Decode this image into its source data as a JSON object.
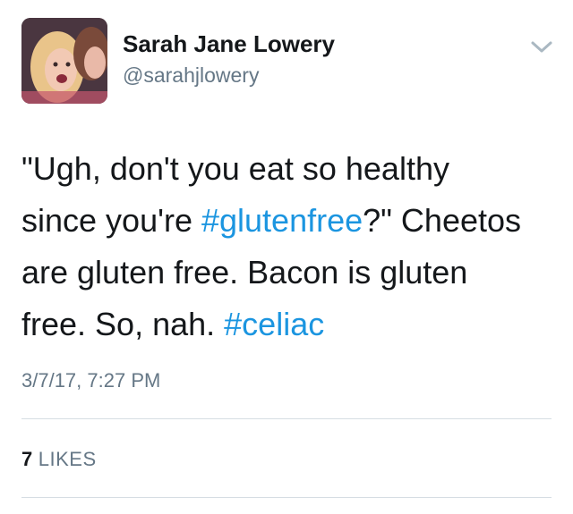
{
  "author": {
    "display_name": "Sarah Jane Lowery",
    "handle": "@sarahjlowery",
    "avatar_icon": "profile-photo"
  },
  "tweet": {
    "lines": [
      [
        {
          "text": "\"Ugh, don't you eat so healthy",
          "hashtag": false
        }
      ],
      [
        {
          "text": "since you're ",
          "hashtag": false
        },
        {
          "text": "#glutenfree",
          "hashtag": true
        },
        {
          "text": "?\" Cheetos",
          "hashtag": false
        }
      ],
      [
        {
          "text": "are gluten free. Bacon is gluten",
          "hashtag": false
        }
      ],
      [
        {
          "text": "free. So, nah. ",
          "hashtag": false
        },
        {
          "text": "#celiac",
          "hashtag": true
        }
      ]
    ],
    "timestamp": "3/7/17, 7:27 PM"
  },
  "stats": {
    "likes_count": "7",
    "likes_label": "LIKES"
  },
  "menu": {
    "icon": "chevron-down-icon"
  },
  "colors": {
    "link": "#1b95e0",
    "secondary_text": "#657786",
    "primary_text": "#14171a",
    "divider": "#d6dde3"
  }
}
